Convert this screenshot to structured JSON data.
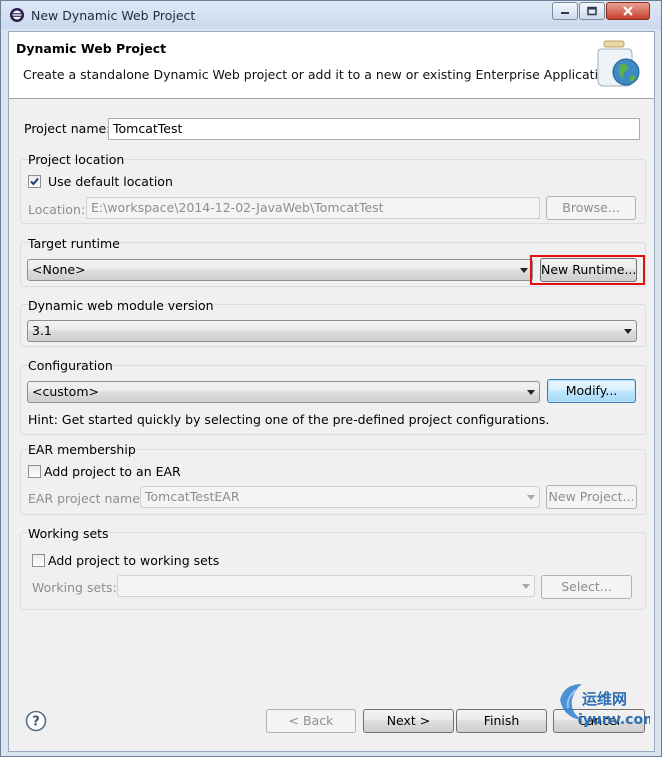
{
  "window": {
    "title": "New Dynamic Web Project"
  },
  "header": {
    "title": "Dynamic Web Project",
    "description": "Create a standalone Dynamic Web project or add it to a new or existing Enterprise Application."
  },
  "project_name": {
    "label": "Project name:",
    "value": "TomcatTest"
  },
  "project_location": {
    "group_label": "Project location",
    "use_default_label": "Use default location",
    "use_default_checked": true,
    "location_label": "Location:",
    "location_value": "E:\\workspace\\2014-12-02-JavaWeb\\TomcatTest",
    "browse_label": "Browse..."
  },
  "target_runtime": {
    "group_label": "Target runtime",
    "selected": "<None>",
    "new_runtime_label": "New Runtime..."
  },
  "module_version": {
    "group_label": "Dynamic web module version",
    "selected": "3.1"
  },
  "configuration": {
    "group_label": "Configuration",
    "selected": "<custom>",
    "modify_label": "Modify...",
    "hint": "Hint: Get started quickly by selecting one of the pre-defined project configurations."
  },
  "ear": {
    "group_label": "EAR membership",
    "add_label": "Add project to an EAR",
    "add_checked": false,
    "project_name_label": "EAR project name:",
    "project_name_value": "TomcatTestEAR",
    "new_project_label": "New Project..."
  },
  "working_sets": {
    "group_label": "Working sets",
    "add_label": "Add project to working sets",
    "add_checked": false,
    "sets_label": "Working sets:",
    "select_label": "Select..."
  },
  "footer": {
    "back_label": "< Back",
    "next_label": "Next >",
    "finish_label": "Finish",
    "cancel_label": "Cancel"
  },
  "watermark": {
    "cn_text": "运维网",
    "url_text": "iyunv.com"
  },
  "colors": {
    "highlight_border": "#e01010",
    "header_bg": "#ffffff",
    "dialog_bg": "#f0f0f0"
  },
  "icons": {
    "app": "eclipse-icon",
    "wizard": "web-project-globe-jar-icon",
    "help": "help-icon"
  }
}
